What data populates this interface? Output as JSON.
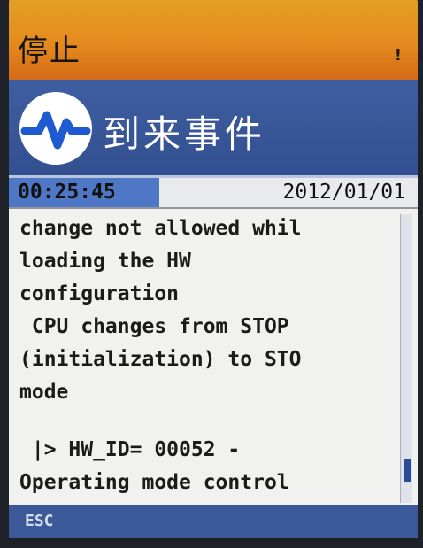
{
  "status_bar": {
    "mode_text": "停止",
    "alert_icon": "!"
  },
  "title_bar": {
    "logo_icon": "pulse-wave-icon",
    "title": "到来事件"
  },
  "info_bar": {
    "time": "00:25:45",
    "date": "2012/01/01"
  },
  "message": {
    "lines": [
      "change not allowed whil",
      "loading the HW",
      "configuration",
      " CPU changes from STOP",
      "(initialization) to STO",
      "mode"
    ],
    "detail_lines": [
      " |> HW_ID= 00052 -",
      "Operating mode control"
    ]
  },
  "scrollbar": {
    "position_fraction": 0.92
  },
  "softkeys": {
    "esc": "ESC"
  },
  "colors": {
    "status_orange": "#e58a1e",
    "title_blue": "#3b5998",
    "time_highlight": "#4e78c6",
    "logo_blue": "#1e5bd1"
  }
}
